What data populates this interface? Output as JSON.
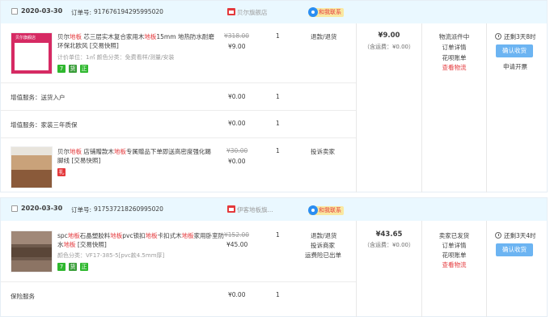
{
  "orders": [
    {
      "date": "2020-03-30",
      "order_no_label": "订单号:",
      "order_no": "917676194295995020",
      "shop": "贝尔旗舰店",
      "contact": "和我联系",
      "items": [
        {
          "title_parts": [
            "贝尔",
            "地板",
            " 芯三层实木复合家用木",
            "地板",
            "15mm 地热防水耐磨环保北欧风 ",
            "[交易快照]"
          ],
          "meta": "计价单位：1㎡  颜色分类：免费看样/测量/安装",
          "orig_price": "¥318.00",
          "price": "¥9.00",
          "qty": "1",
          "action": "退款/退货",
          "badges": [
            "7",
            "货",
            "正"
          ],
          "thumb_text": "贝尔旗舰店"
        },
        {
          "service": "增值服务：送货入户",
          "price": "¥0.00",
          "qty": "1"
        },
        {
          "service": "增值服务：家装三年质保",
          "price": "¥0.00",
          "qty": "1"
        },
        {
          "title_parts": [
            "贝尔",
            "地板",
            " 店铺赠款木",
            "地板",
            "专属赠品下单即送高密度强化踢脚线 ",
            "[交易快照]"
          ],
          "orig_price": "¥30.00",
          "price": "¥0.00",
          "qty": "1",
          "action": "投诉卖家",
          "badges": [
            "礼"
          ]
        }
      ],
      "total": "¥9.00",
      "shipping": "（含运费：¥0.00）",
      "status": [
        "物流派件中",
        "订单详情",
        "花呗账单",
        "查看物流"
      ],
      "countdown": "还剩3天8时",
      "confirm": "确认收货",
      "refund": "申请开票"
    },
    {
      "date": "2020-03-30",
      "order_no_label": "订单号:",
      "order_no": "917537218260995020",
      "shop": "伊客地板旗...",
      "contact": "和我联系",
      "items": [
        {
          "title_parts": [
            "spc",
            "地板",
            "石晶塑胶料",
            "地板",
            "pvc锁扣",
            "地板",
            "卡扣式木",
            "地板",
            "家用卧室防水",
            "地板",
            " ",
            "[交易快照]"
          ],
          "meta": "颜色分类：VF17-385-5[pvc款4.5mm厚]",
          "orig_price": "¥152.00",
          "price": "¥45.00",
          "qty": "1",
          "actions": [
            "退款/退货",
            "投诉商家",
            "运费险已出单"
          ],
          "badges": [
            "7",
            "货",
            "正"
          ]
        },
        {
          "service": "保险服务",
          "price": "¥0.00",
          "qty": "1"
        }
      ],
      "total": "¥43.65",
      "shipping": "（含运费：¥0.00）",
      "status": [
        "卖家已发货",
        "订单详情",
        "花呗账单",
        "查看物流"
      ],
      "countdown": "还剩3天4时",
      "confirm": "确认收货"
    }
  ],
  "colors": {
    "accent": "#e4393c",
    "header_bg": "#eaf8ff",
    "button": "#6cb4f2"
  }
}
